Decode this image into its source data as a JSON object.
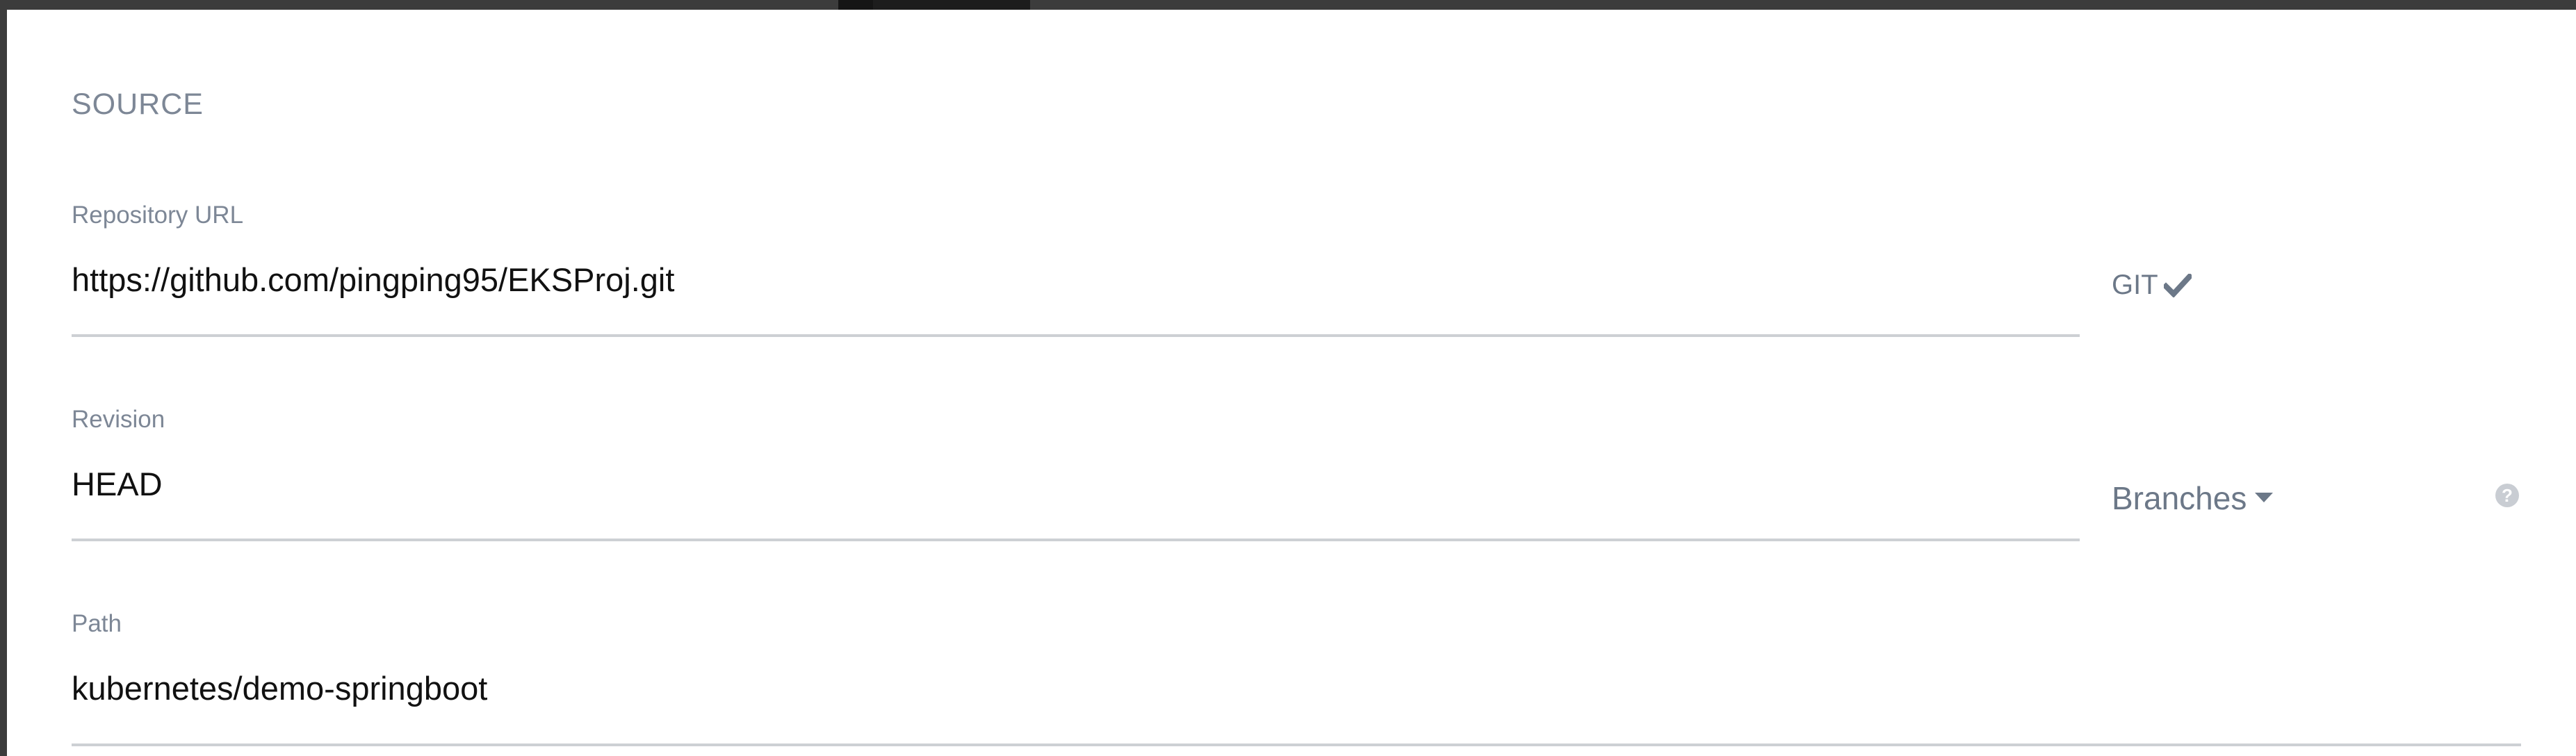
{
  "section": {
    "title": "SOURCE"
  },
  "repository": {
    "label": "Repository URL",
    "value": "https://github.com/pingping95/EKSProj.git",
    "type_label": "GIT",
    "type_icon": "check-icon"
  },
  "revision": {
    "label": "Revision",
    "value": "HEAD",
    "selector_label": "Branches",
    "selector_icon": "caret-down-icon",
    "help_icon": "question-circle-icon",
    "help_glyph": "?"
  },
  "path": {
    "label": "Path",
    "value": "kubernetes/demo-springboot"
  },
  "colors": {
    "label": "#7d8796",
    "value": "#111111",
    "underline": "#cdd0d4",
    "accent": "#6c7888"
  }
}
